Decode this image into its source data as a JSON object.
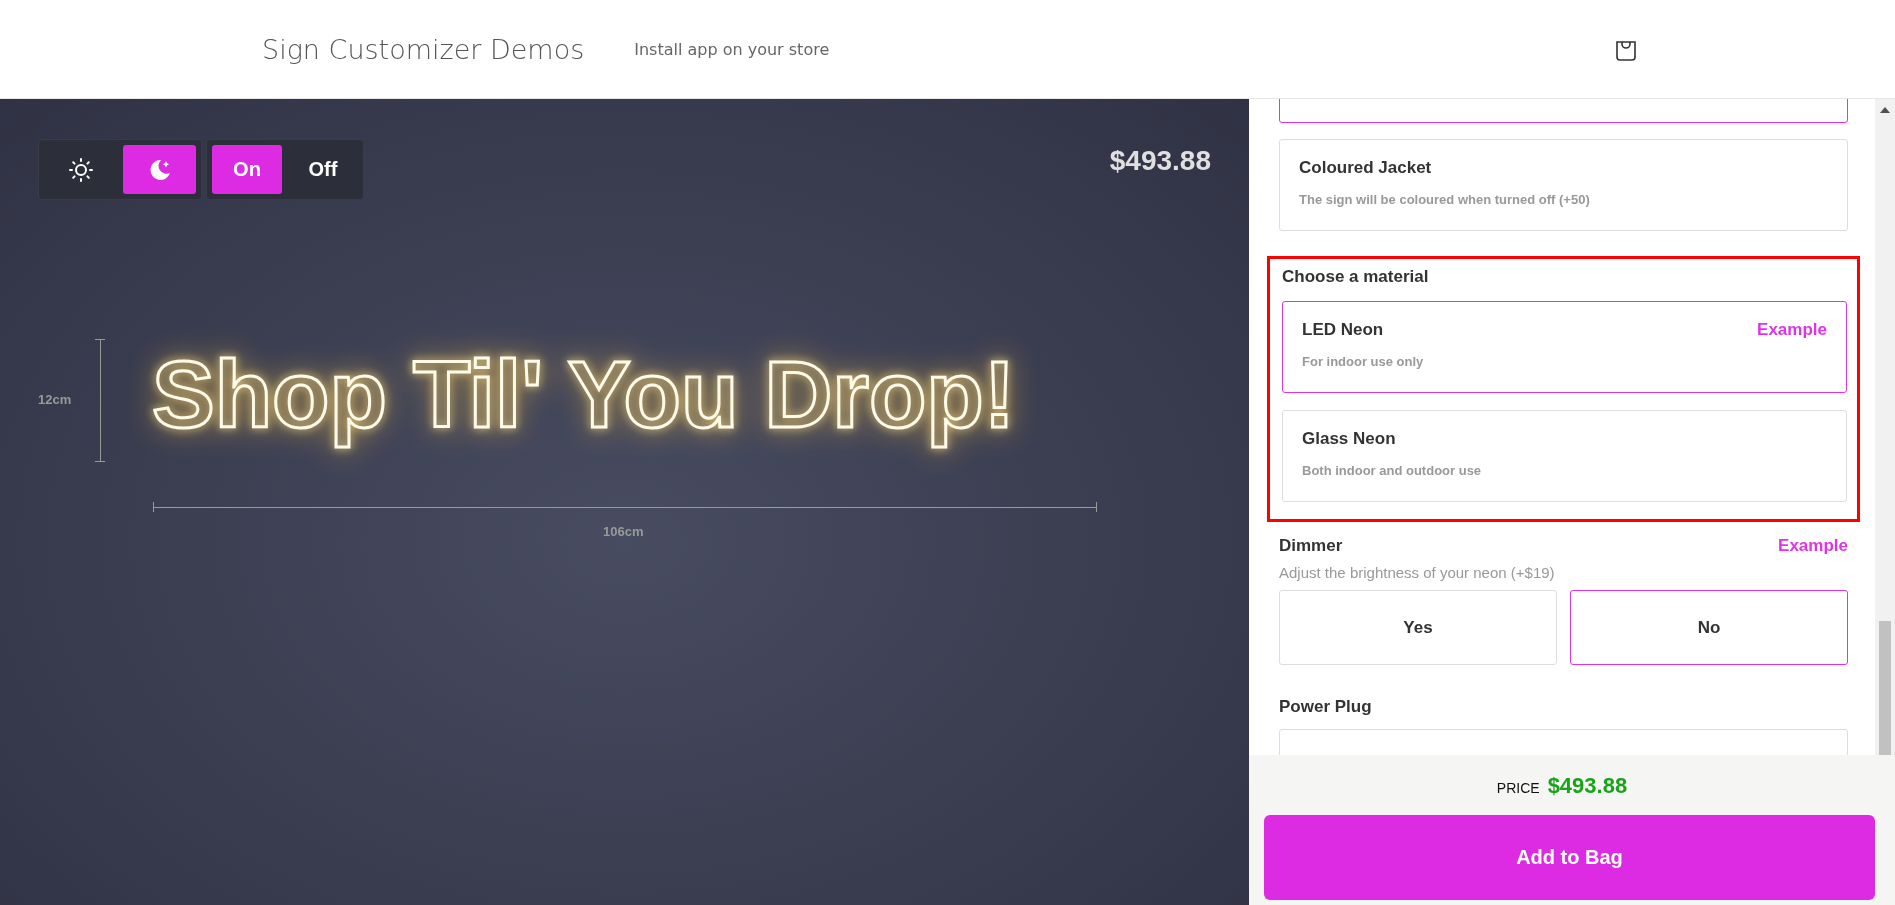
{
  "header": {
    "store_title": "Sign Customizer Demos",
    "install_link": "Install app on your store"
  },
  "preview": {
    "theme_modes": [
      {
        "kind": "light",
        "selected": false
      },
      {
        "kind": "dark",
        "selected": true
      }
    ],
    "power": [
      {
        "label": "On",
        "selected": true
      },
      {
        "label": "Off",
        "selected": false
      }
    ],
    "price": "$493.88",
    "sign_text": "Shop Til' You Drop!",
    "height_label": "12cm",
    "width_label": "106cm"
  },
  "jacket_options": [
    {
      "selected": true
    },
    {
      "title": "Coloured Jacket",
      "description": "The sign will be coloured when turned off (+50)",
      "selected": false
    }
  ],
  "material": {
    "heading": "Choose a material",
    "highlighted": true,
    "options": [
      {
        "title": "LED Neon",
        "description": "For indoor use only",
        "example_link": "Example",
        "selected": true
      },
      {
        "title": "Glass Neon",
        "description": "Both indoor and outdoor use",
        "selected": false
      }
    ]
  },
  "dimmer": {
    "heading": "Dimmer",
    "example_link": "Example",
    "description": "Adjust the brightness of your neon (+$19)",
    "options": [
      {
        "label": "Yes",
        "selected": false
      },
      {
        "label": "No",
        "selected": true
      }
    ]
  },
  "power_plug": {
    "heading": "Power Plug"
  },
  "footer": {
    "price_label": "PRICE",
    "price": "$493.88",
    "add_button": "Add to Bag"
  }
}
